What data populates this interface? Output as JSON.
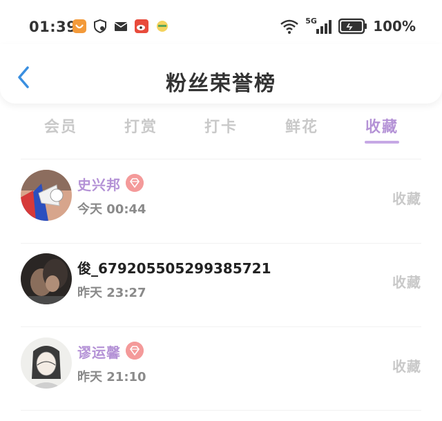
{
  "status_bar": {
    "time": "01:39",
    "battery": "100%",
    "network": "5G",
    "left_icons": [
      "app-orange-icon",
      "shield-icon",
      "mail-icon",
      "weibo-icon",
      "bird-icon"
    ]
  },
  "header": {
    "title": "粉丝荣誉榜"
  },
  "tabs": [
    {
      "label": "会员",
      "active": false
    },
    {
      "label": "打赏",
      "active": false
    },
    {
      "label": "打卡",
      "active": false
    },
    {
      "label": "鲜花",
      "active": false
    },
    {
      "label": "收藏",
      "active": true
    }
  ],
  "colors": {
    "accent": "#b492d6",
    "inactive": "#c9c9c9",
    "badge": "#f49a9a"
  },
  "list": [
    {
      "name": "史兴邦",
      "vip": true,
      "time": "今天 00:44",
      "action": "收藏"
    },
    {
      "name": "俊_679205505299385721",
      "vip": false,
      "time": "昨天 23:27",
      "action": "收藏"
    },
    {
      "name": "谬运馨",
      "vip": true,
      "time": "昨天 21:10",
      "action": "收藏"
    }
  ]
}
